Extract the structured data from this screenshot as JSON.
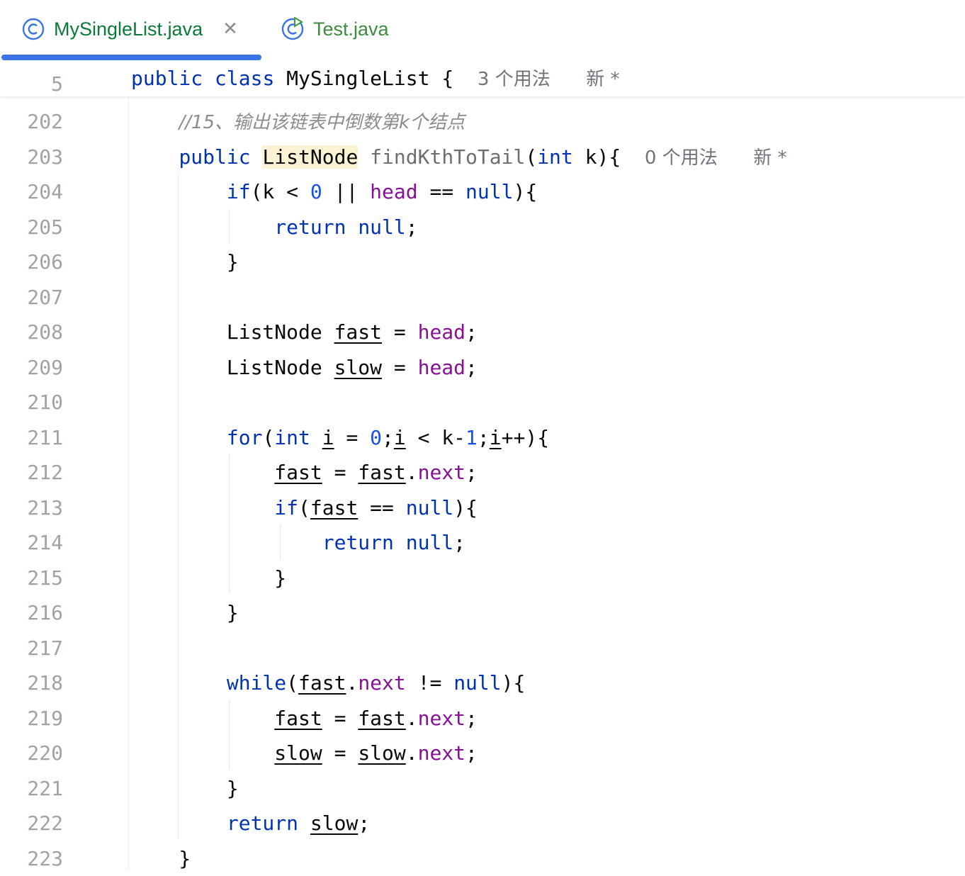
{
  "tabs": [
    {
      "label": "MySingleList.java",
      "active": true,
      "icon": "java-class-icon"
    },
    {
      "label": "Test.java",
      "active": false,
      "icon": "java-test-class-icon"
    }
  ],
  "sticky": {
    "line_number": "5",
    "kw1": "public",
    "kw2": "class",
    "name": "MySingleList",
    "brace": "{",
    "usages": "3 个用法",
    "author": "新 *"
  },
  "line_numbers": [
    "202",
    "203",
    "204",
    "205",
    "206",
    "207",
    "208",
    "209",
    "210",
    "211",
    "212",
    "213",
    "214",
    "215",
    "216",
    "217",
    "218",
    "219",
    "220",
    "221",
    "222",
    "223"
  ],
  "code": {
    "comment": "//15、输出该链表中倒数第k个结点",
    "method_usages": "0 个用法",
    "method_author": "新 *"
  },
  "colors": {
    "keyword": "#0033b3",
    "field": "#871094",
    "number": "#1750eb",
    "tab_accent": "#3a74e6"
  }
}
